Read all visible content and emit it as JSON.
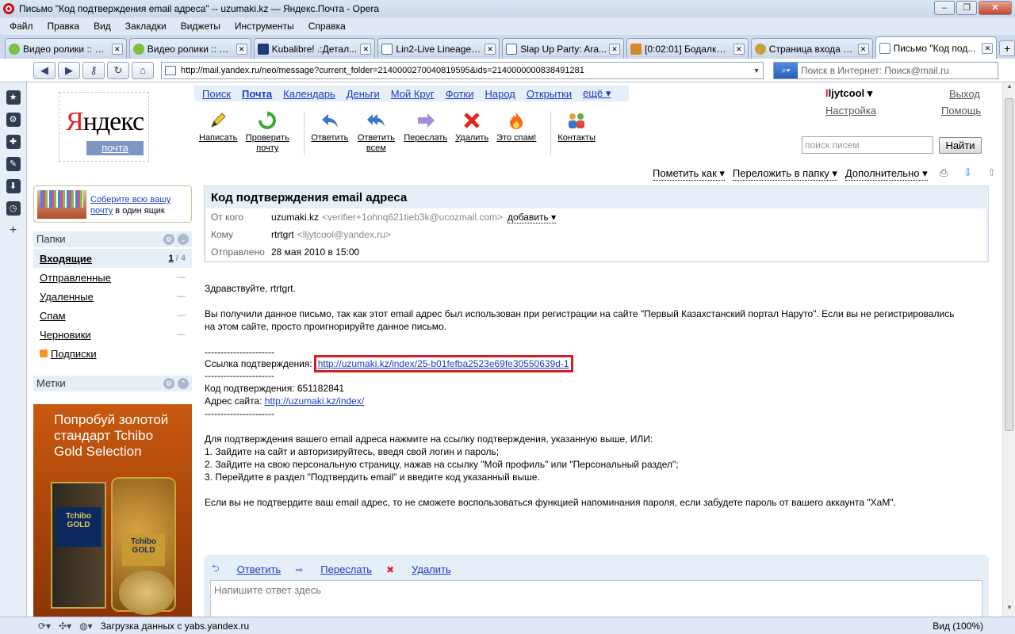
{
  "window": {
    "title": "Письмо \"Код подтверждения email адреса\" -- uzumaki.kz — Яндекс.Почта - Opera"
  },
  "menu": [
    "Файл",
    "Правка",
    "Вид",
    "Закладки",
    "Виджеты",
    "Инструменты",
    "Справка"
  ],
  "tabs": [
    {
      "label": "Видео ролики :: П...",
      "color": "#7bc142"
    },
    {
      "label": "Видео ролики :: П...",
      "color": "#7bc142"
    },
    {
      "label": "Kubalibre! .:Детал...",
      "color": "#1e3c7c"
    },
    {
      "label": "Lin2-Live Lineage2...",
      "color": "#5a6f8a"
    },
    {
      "label": "Slap Up Party: Ara...",
      "color": "#4a6a9a"
    },
    {
      "label": "[0:02:01] Бодалка. ...",
      "color": "#d88a2a"
    },
    {
      "label": "Страница входа - ...",
      "color": "#c7a23a"
    },
    {
      "label": "Письмо \"Код под...",
      "color": "#5a86c6",
      "active": true
    }
  ],
  "address": {
    "url": "http://mail.yandex.ru/neo/message?current_folder=2140000270040819595&ids=2140000000838491281",
    "search_placeholder": "Поиск в Интернет: Поиск@mail.ru"
  },
  "logo": {
    "text": "Яндекс",
    "sub": "почта"
  },
  "topnav": [
    "Поиск",
    "Почта",
    "Календарь",
    "Деньги",
    "Мой Круг",
    "Фотки",
    "Народ",
    "Открытки",
    "ещё ▾"
  ],
  "toolbar": [
    {
      "label": "Написать",
      "icon": "pencil-icon"
    },
    {
      "label": "Проверить почту",
      "icon": "refresh-icon"
    },
    {
      "label": "Ответить",
      "icon": "reply-icon"
    },
    {
      "label": "Ответить всем",
      "icon": "reply-all-icon"
    },
    {
      "label": "Переслать",
      "icon": "forward-icon"
    },
    {
      "label": "Удалить",
      "icon": "delete-icon"
    },
    {
      "label": "Это спам!",
      "icon": "spam-icon"
    },
    {
      "label": "Контакты",
      "icon": "contacts-icon"
    }
  ],
  "user": {
    "name": "llјytcool ▾",
    "settings": "Настройка",
    "logout": "Выход",
    "help": "Помощь"
  },
  "mail_search": {
    "placeholder": "поиск писем",
    "button": "Найти"
  },
  "actions": [
    "Пометить как ▾",
    "Переложить в папку ▾",
    "Дополнительно ▾"
  ],
  "promo": {
    "link": "Соберите всю вашу почту",
    "rest": " в один ящик"
  },
  "folders_title": "Папки",
  "folders": [
    {
      "name": "Входящие",
      "unread": "1",
      "total": "/ 4",
      "active": true
    },
    {
      "name": "Отправленные",
      "unread": "—"
    },
    {
      "name": "Удаленные",
      "unread": "—"
    },
    {
      "name": "Спам",
      "unread": "—"
    },
    {
      "name": "Черновики",
      "unread": "—"
    },
    {
      "name": "Подписки",
      "rss": true
    }
  ],
  "labels_title": "Метки",
  "ad": {
    "text": "Попробуй золотой стандарт Tchibo Gold Selection",
    "jar_label": "Tchibo GOLD",
    "jar2_label": "Tchibo GOLD"
  },
  "message": {
    "subject": "Код подтверждения email адреса",
    "from_label": "От кого",
    "from_name": "uzumaki.kz",
    "from_addr": "<verifier+1ohnq621tieb3k@ucozmail.com>",
    "add": "добавить ▾",
    "to_label": "Кому",
    "to_name": "rtrtgrt",
    "to_addr": "<lljytcool@yandex.ru>",
    "sent_label": "Отправлено",
    "sent_date": "28 мая 2010 в 15:00",
    "greeting": "Здравствуйте, rtrtgrt.",
    "para1": "Вы получили данное письмо, так как этот email адрес был использован при регистрации на сайте \"Первый Казахстанский портал Наруто\". Если вы не регистрировались на этом сайте, просто проигнорируйте данное письмо.",
    "divider": "----------------------",
    "confirm_label": "Ссылка подтверждения:",
    "confirm_link": "http://uzumaki.kz/index/25-b01fefba2523e69fe30550639d-1",
    "code_label": "Код подтверждения: 651182841",
    "site_label": "Адрес сайта:",
    "site_link": "http://uzumaki.kz/index/",
    "instr": "Для подтверждения вашего email адреса нажмите на ссылку подтверждения, указанную выше, ИЛИ:",
    "step1": "1. Зайдите на сайт и авторизируйтесь, введя свой логин и пароль;",
    "step2": "2. Зайдите на свою персональную страницу, нажав на ссылку \"Мой профиль\" или \"Персональный раздел\";",
    "step3": "3. Перейдите в раздел \"Подтвердить email\" и введите код указанный выше.",
    "footer": "Если вы не подтвердите ваш email адрес, то не сможете воспользоваться функцией напоминания пароля, если забудете пароль от вашего аккаунта \"ХаМ\"."
  },
  "reply": {
    "reply": "Ответить",
    "forward": "Переслать",
    "delete": "Удалить",
    "placeholder": "Напишите ответ здесь"
  },
  "status": {
    "text": "Загрузка данных с yabs.yandex.ru",
    "zoom": "Вид (100%)"
  }
}
